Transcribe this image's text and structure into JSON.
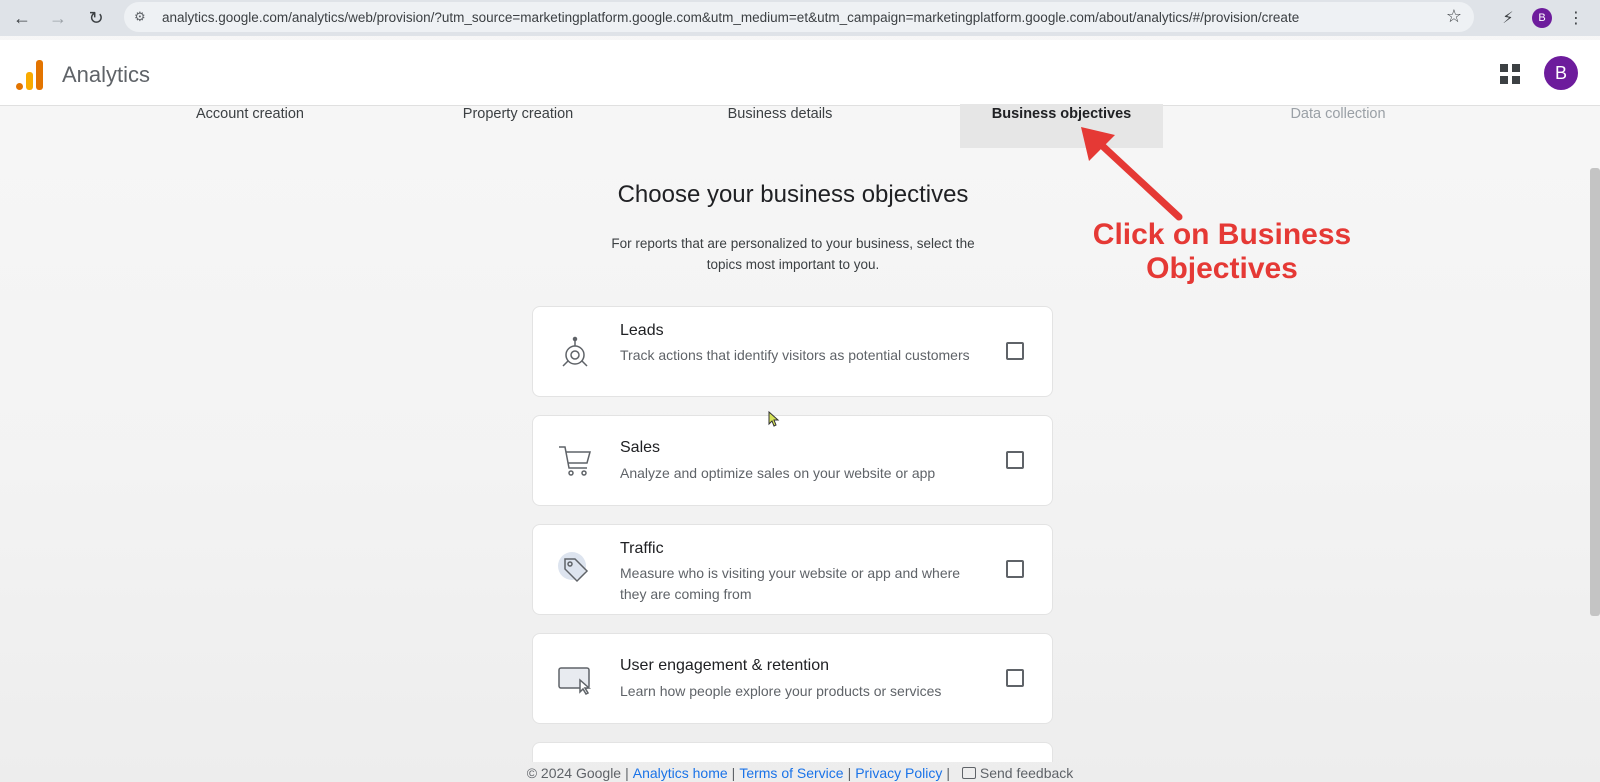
{
  "browser": {
    "url": "analytics.google.com/analytics/web/provision/?utm_source=marketingplatform.google.com&utm_medium=et&utm_campaign=marketingplatform.google.com/about/analytics/#/provision/create",
    "profile_initial": "B"
  },
  "header": {
    "app_title": "Analytics",
    "user_initial": "B"
  },
  "stepper": {
    "steps": [
      {
        "label": "Account creation",
        "state": "complete"
      },
      {
        "label": "Property creation",
        "state": "complete"
      },
      {
        "label": "Business details",
        "state": "complete"
      },
      {
        "label": "Business objectives",
        "state": "active"
      },
      {
        "label": "Data collection",
        "state": "disabled"
      }
    ]
  },
  "main": {
    "title": "Choose your business objectives",
    "subtitle": "For reports that are personalized to your business, select the topics most important to you.",
    "objectives": [
      {
        "title": "Leads",
        "description": "Track actions that identify visitors as potential customers",
        "icon": "target-icon",
        "checked": false
      },
      {
        "title": "Sales",
        "description": "Analyze and optimize sales on your website or app",
        "icon": "shopping-cart-icon",
        "checked": false
      },
      {
        "title": "Traffic",
        "description": "Measure who is visiting your website or app and where they are coming from",
        "icon": "tag-icon",
        "checked": false
      },
      {
        "title": "User engagement & retention",
        "description": "Learn how people explore your products or services",
        "icon": "screen-pointer-icon",
        "checked": false
      }
    ]
  },
  "annotation": {
    "text": "Click on Business Objectives",
    "color": "#e53935"
  },
  "footer": {
    "copyright": "© 2024 Google",
    "analytics_home": "Analytics home",
    "terms": "Terms of Service",
    "privacy": "Privacy Policy",
    "feedback": "Send feedback"
  },
  "colors": {
    "accent": "#1a73e8",
    "avatar": "#6d1c9c",
    "logo_orange": "#e37400",
    "logo_yellow": "#f9ab00"
  }
}
